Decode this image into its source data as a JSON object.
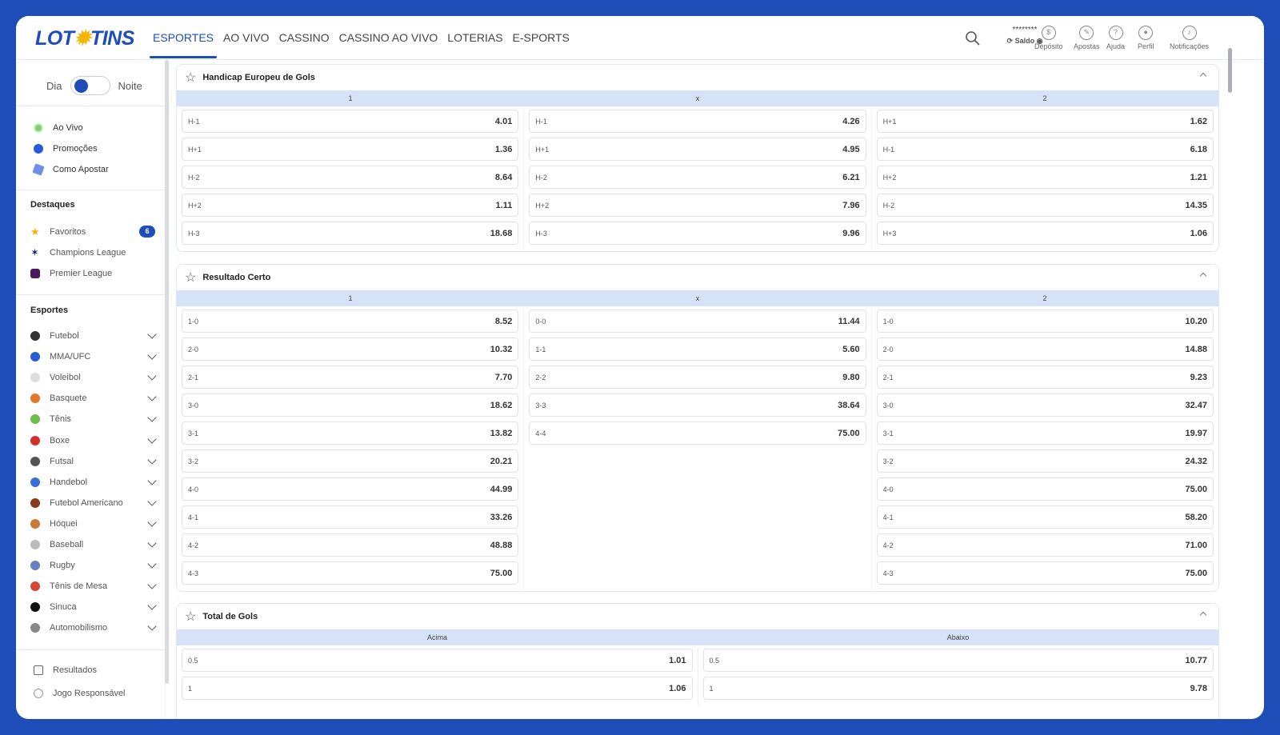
{
  "header": {
    "logo": "LOT",
    "logo_end": "TINS",
    "nav": [
      "ESPORTES",
      "AO VIVO",
      "CASSINO",
      "CASSINO AO VIVO",
      "LOTERIAS",
      "E-SPORTS"
    ],
    "balance_mask": "********",
    "balance_label": "Saldo",
    "buttons": [
      "Depósito",
      "Apostas",
      "Ajuda",
      "Perfil",
      "Notificações"
    ]
  },
  "sidebar": {
    "day": "Dia",
    "night": "Noite",
    "quick": [
      "Ao Vivo",
      "Promoções",
      "Como Apostar"
    ],
    "highlights_title": "Destaques",
    "highlights": [
      "Favoritos",
      "Champions League",
      "Premier League"
    ],
    "favorites_count": "6",
    "sports_title": "Esportes",
    "sports": [
      "Futebol",
      "MMA/UFC",
      "Voleibol",
      "Basquete",
      "Tênis",
      "Boxe",
      "Futsal",
      "Handebol",
      "Futebol Americano",
      "Hóquei",
      "Baseball",
      "Rugby",
      "Tênis de Mesa",
      "Sinuca",
      "Automobilismo"
    ],
    "bottom": [
      "Resultados",
      "Jogo Responsável"
    ]
  },
  "markets": {
    "handicap": {
      "title": "Handicap Europeu de Gols",
      "headers": [
        "1",
        "x",
        "2"
      ],
      "cols": [
        [
          [
            "H-1",
            "4.01"
          ],
          [
            "H+1",
            "1.36"
          ],
          [
            "H-2",
            "8.64"
          ],
          [
            "H+2",
            "1.11"
          ],
          [
            "H-3",
            "18.68"
          ]
        ],
        [
          [
            "H-1",
            "4.26"
          ],
          [
            "H+1",
            "4.95"
          ],
          [
            "H-2",
            "6.21"
          ],
          [
            "H+2",
            "7.96"
          ],
          [
            "H-3",
            "9.96"
          ]
        ],
        [
          [
            "H+1",
            "1.62"
          ],
          [
            "H-1",
            "6.18"
          ],
          [
            "H+2",
            "1.21"
          ],
          [
            "H-2",
            "14.35"
          ],
          [
            "H+3",
            "1.06"
          ]
        ]
      ]
    },
    "correct": {
      "title": "Resultado Certo",
      "headers": [
        "1",
        "x",
        "2"
      ],
      "cols": [
        [
          [
            "1-0",
            "8.52"
          ],
          [
            "2-0",
            "10.32"
          ],
          [
            "2-1",
            "7.70"
          ],
          [
            "3-0",
            "18.62"
          ],
          [
            "3-1",
            "13.82"
          ],
          [
            "3-2",
            "20.21"
          ],
          [
            "4-0",
            "44.99"
          ],
          [
            "4-1",
            "33.26"
          ],
          [
            "4-2",
            "48.88"
          ],
          [
            "4-3",
            "75.00"
          ]
        ],
        [
          [
            "0-0",
            "11.44"
          ],
          [
            "1-1",
            "5.60"
          ],
          [
            "2-2",
            "9.80"
          ],
          [
            "3-3",
            "38.64"
          ],
          [
            "4-4",
            "75.00"
          ]
        ],
        [
          [
            "1-0",
            "10.20"
          ],
          [
            "2-0",
            "14.88"
          ],
          [
            "2-1",
            "9.23"
          ],
          [
            "3-0",
            "32.47"
          ],
          [
            "3-1",
            "19.97"
          ],
          [
            "3-2",
            "24.32"
          ],
          [
            "4-0",
            "75.00"
          ],
          [
            "4-1",
            "58.20"
          ],
          [
            "4-2",
            "71.00"
          ],
          [
            "4-3",
            "75.00"
          ]
        ]
      ]
    },
    "total": {
      "title": "Total de Gols",
      "headers": [
        "Acima",
        "Abaixo"
      ],
      "cols": [
        [
          [
            "0.5",
            "1.01"
          ],
          [
            "1",
            "1.06"
          ]
        ],
        [
          [
            "0.5",
            "10.77"
          ],
          [
            "1",
            "9.78"
          ]
        ]
      ]
    }
  },
  "colors": {
    "brand": "#1e4db7",
    "accent": "#f5b400",
    "column_header": "#d6e2f7"
  }
}
